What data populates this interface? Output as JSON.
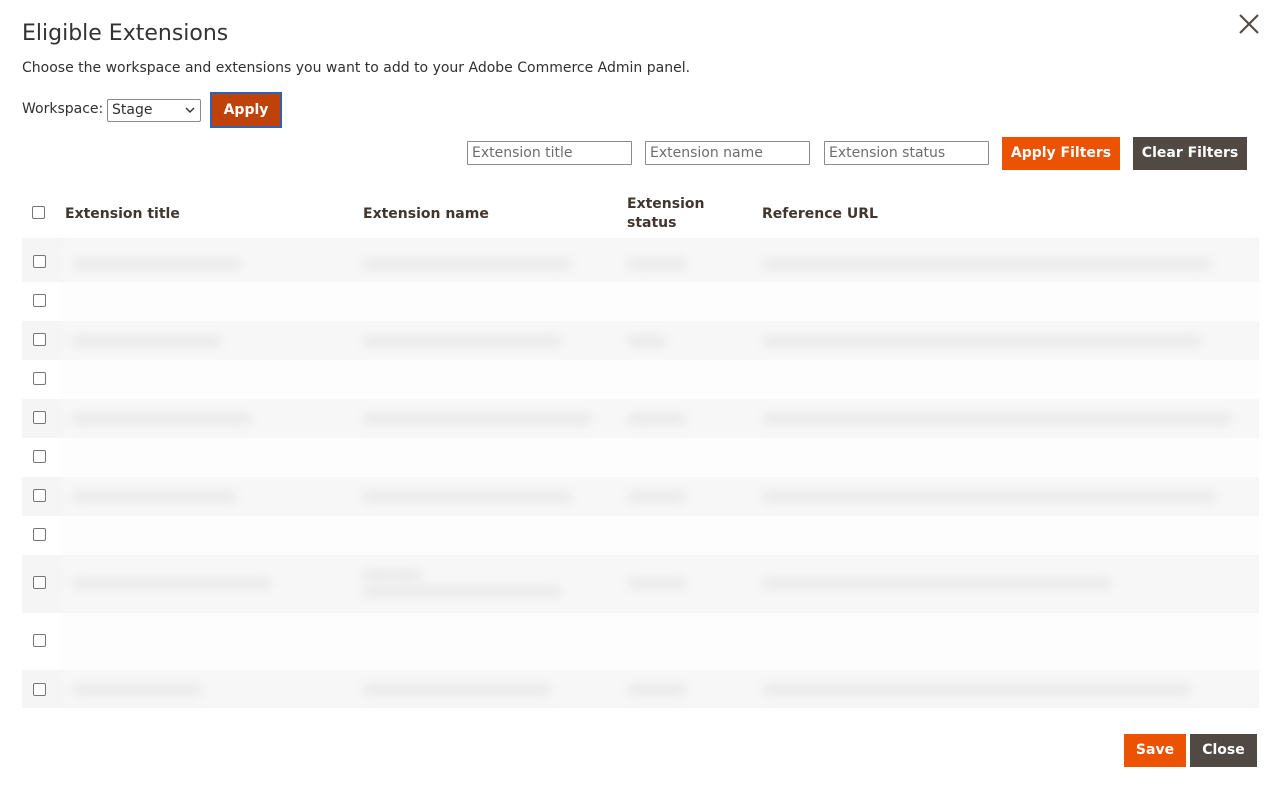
{
  "dialog": {
    "title": "Eligible Extensions",
    "description": "Choose the workspace and extensions you want to add to your Adobe Commerce Admin panel.",
    "close_icon": "close-icon"
  },
  "workspace": {
    "label": "Workspace:",
    "selected": "Stage",
    "apply_label": "Apply"
  },
  "filters": {
    "title_placeholder": "Extension title",
    "name_placeholder": "Extension name",
    "status_placeholder": "Extension status",
    "apply_label": "Apply Filters",
    "clear_label": "Clear Filters"
  },
  "table": {
    "headers": {
      "title": "Extension title",
      "name": "Extension name",
      "status_line1": "Extension",
      "status_line2": "status",
      "url": "Reference URL"
    },
    "rows_blurred": true
  },
  "footer": {
    "save_label": "Save",
    "close_label": "Close"
  },
  "colors": {
    "primary_orange": "#eb5202",
    "apply_dark_orange": "#c0420b",
    "secondary_dark": "#514943",
    "row_shade": "#f5f5f5"
  }
}
